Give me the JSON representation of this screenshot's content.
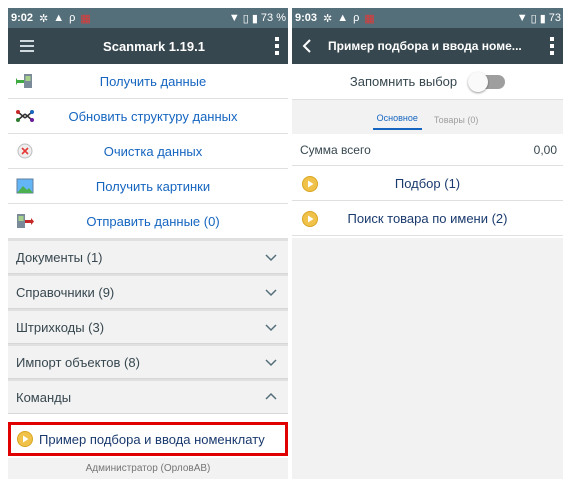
{
  "left": {
    "status": {
      "time": "9:02",
      "battery": "73 %"
    },
    "app_title": "Scanmark 1.19.1",
    "actions": [
      {
        "label": "Получить данные",
        "icon": "device-download-icon"
      },
      {
        "label": "Обновить структуру данных",
        "icon": "structure-icon"
      },
      {
        "label": "Очистка данных",
        "icon": "clear-x-icon"
      },
      {
        "label": "Получить картинки",
        "icon": "picture-icon"
      },
      {
        "label": "Отправить данные (0)",
        "icon": "device-upload-icon"
      }
    ],
    "sections": [
      {
        "label": "Документы (1)",
        "state": "collapsed"
      },
      {
        "label": "Справочники (9)",
        "state": "collapsed"
      },
      {
        "label": "Штрихкоды (3)",
        "state": "collapsed"
      },
      {
        "label": "Импорт объектов (8)",
        "state": "collapsed"
      },
      {
        "label": "Команды",
        "state": "expanded"
      }
    ],
    "command": {
      "label": "Пример подбора и ввода номенклату"
    },
    "footer": "Администратор (ОрловАВ)"
  },
  "right": {
    "status": {
      "time": "9:03",
      "battery": "73"
    },
    "app_title": "Пример подбора и ввода номе...",
    "remember_label": "Запомнить выбор",
    "remember_on": false,
    "tabs": [
      {
        "label": "Основное",
        "active": true
      },
      {
        "label": "Товары (0)",
        "active": false
      }
    ],
    "sum_label": "Сумма всего",
    "sum_value": "0,00",
    "items": [
      {
        "label": "Подбор (1)"
      },
      {
        "label": "Поиск товара по имени (2)"
      }
    ]
  },
  "colors": {
    "appbar": "#37474f",
    "statusbar": "#546e7a",
    "link": "#1565c0",
    "highlight": "#e00000",
    "play": "#f0c24a"
  }
}
